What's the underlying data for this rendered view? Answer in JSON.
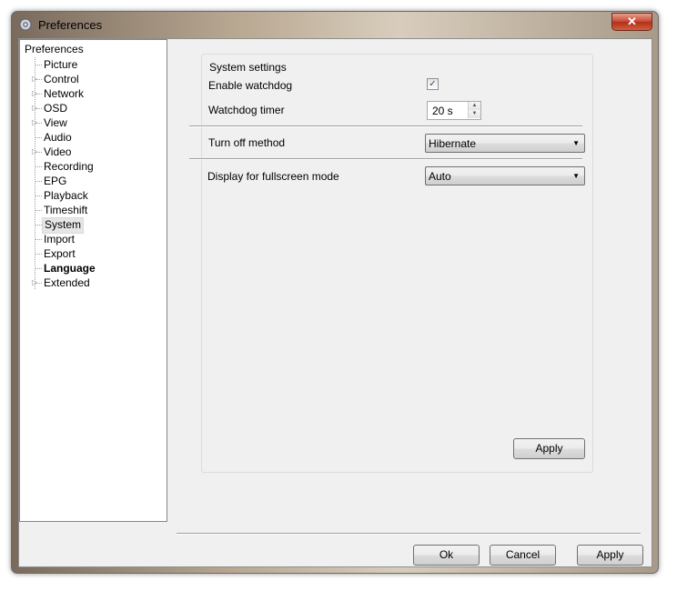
{
  "window": {
    "title": "Preferences",
    "close_label": "✕"
  },
  "tree": {
    "root": "Preferences",
    "items": [
      {
        "label": "Picture",
        "expandable": false
      },
      {
        "label": "Control",
        "expandable": true
      },
      {
        "label": "Network",
        "expandable": true
      },
      {
        "label": "OSD",
        "expandable": true
      },
      {
        "label": "View",
        "expandable": true
      },
      {
        "label": "Audio",
        "expandable": false
      },
      {
        "label": "Video",
        "expandable": true
      },
      {
        "label": "Recording",
        "expandable": false
      },
      {
        "label": "EPG",
        "expandable": false
      },
      {
        "label": "Playback",
        "expandable": false
      },
      {
        "label": "Timeshift",
        "expandable": false
      },
      {
        "label": "System",
        "expandable": false,
        "selected": true
      },
      {
        "label": "Import",
        "expandable": false
      },
      {
        "label": "Export",
        "expandable": false
      },
      {
        "label": "Language",
        "expandable": false,
        "bold": true
      },
      {
        "label": "Extended",
        "expandable": true
      }
    ]
  },
  "settings": {
    "group_title": "System settings",
    "enable_watchdog": {
      "label": "Enable watchdog",
      "checked": true,
      "check_glyph": "✓"
    },
    "watchdog_timer": {
      "label": "Watchdog timer",
      "value": "20 s",
      "up": "▲",
      "down": "▼"
    },
    "turn_off_method": {
      "label": "Turn off method",
      "value": "Hibernate",
      "arrow": "▼"
    },
    "fullscreen_display": {
      "label": "Display for fullscreen mode",
      "value": "Auto",
      "arrow": "▼"
    },
    "apply_label": "Apply"
  },
  "footer": {
    "ok_label": "Ok",
    "cancel_label": "Cancel",
    "apply_label": "Apply"
  },
  "colors": {
    "close_button": "#c6452f",
    "selection": "#e6e6e6",
    "dialog_bg": "#f0f0f0"
  }
}
